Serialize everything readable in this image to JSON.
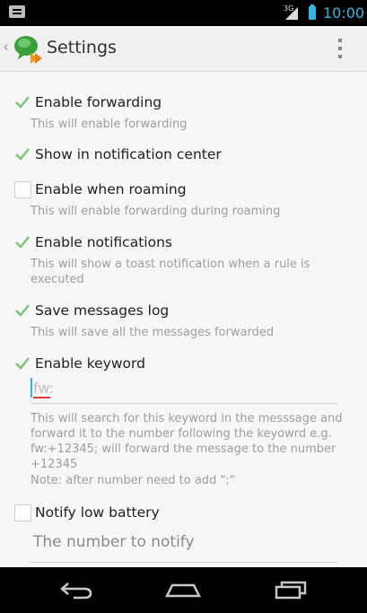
{
  "status_bar": {
    "network": "3G",
    "time": "10:00"
  },
  "action_bar": {
    "title": "Settings"
  },
  "preferences": [
    {
      "title": "Enable forwarding",
      "summary": "This will enable forwarding",
      "checked": true
    },
    {
      "title": "Show in notification center",
      "summary": "",
      "checked": true
    },
    {
      "title": "Enable when roaming",
      "summary": "This will enable forwarding during roaming",
      "checked": false
    },
    {
      "title": "Enable notifications",
      "summary": "This will show a toast notification when a rule is executed",
      "checked": true
    },
    {
      "title": "Save messages log",
      "summary": "This will save all the messages forwarded",
      "checked": true
    },
    {
      "title": "Enable keyword",
      "summary": "",
      "checked": true
    },
    {
      "title": "Notify low battery",
      "summary": "",
      "checked": false
    }
  ],
  "keyword": {
    "value": "fw:",
    "help_line1": "This will search for this keyword in the messsage and forward it to the number following the keyowrd e.g. fw:+12345; will forward the message to the number +12345",
    "help_line2": "Note: after number need to add \";\""
  },
  "notify_number": {
    "placeholder": "The number to notify"
  },
  "colors": {
    "accent": "#33b5e5",
    "check": "#7cc576"
  }
}
